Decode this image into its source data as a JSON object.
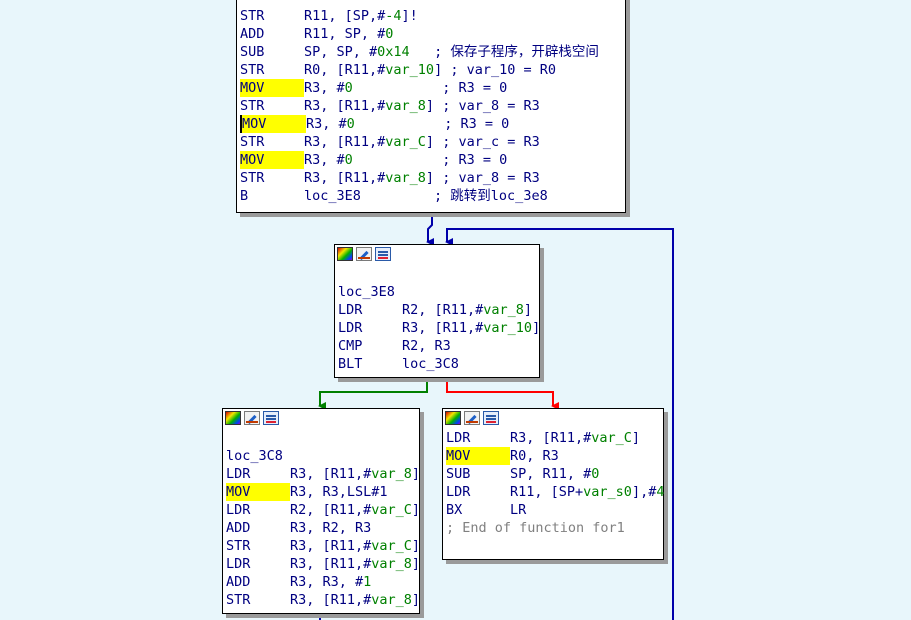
{
  "colors": {
    "background": "#e8f6fb",
    "normal_edge": "#0000aa",
    "true_edge": "#008000",
    "false_edge": "#ff0000",
    "highlight": "#ffff00"
  },
  "icons": [
    "graph-overview-icon",
    "edit-comment-icon",
    "xrefs-icon"
  ],
  "blocks": [
    {
      "id": "entry",
      "label": "",
      "lines": [
        {
          "m": "STR",
          "o": [
            [
              "t",
              "R11, [SP,#"
            ],
            [
              "n",
              "-4"
            ],
            [
              "t",
              "]!"
            ]
          ]
        },
        {
          "m": "ADD",
          "o": [
            [
              "t",
              "R11, SP, #"
            ],
            [
              "n",
              "0"
            ]
          ]
        },
        {
          "m": "SUB",
          "o": [
            [
              "t",
              "SP, SP, #"
            ],
            [
              "n",
              "0x14"
            ],
            [
              "t",
              "   "
            ],
            [
              "c",
              "; 保存子程序，开辟栈空间"
            ]
          ]
        },
        {
          "m": "STR",
          "o": [
            [
              "t",
              "R0, [R11,#"
            ],
            [
              "v",
              "var_10"
            ],
            [
              "t",
              "] "
            ],
            [
              "c",
              "; var_10 = R0"
            ]
          ]
        },
        {
          "m": "MOV",
          "hl": true,
          "o": [
            [
              "t",
              "R3, #"
            ],
            [
              "n",
              "0"
            ],
            [
              "t",
              "           "
            ],
            [
              "c",
              "; R3 = 0"
            ]
          ]
        },
        {
          "m": "STR",
          "o": [
            [
              "t",
              "R3, [R11,#"
            ],
            [
              "v",
              "var_8"
            ],
            [
              "t",
              "] "
            ],
            [
              "c",
              "; var_8 = R3"
            ]
          ]
        },
        {
          "m": "MOV",
          "hl": true,
          "cursor": true,
          "o": [
            [
              "t",
              "R3, #"
            ],
            [
              "n",
              "0"
            ],
            [
              "t",
              "           "
            ],
            [
              "c",
              "; R3 = 0"
            ]
          ]
        },
        {
          "m": "STR",
          "o": [
            [
              "t",
              "R3, [R11,#"
            ],
            [
              "v",
              "var_C"
            ],
            [
              "t",
              "] "
            ],
            [
              "c",
              "; var_c = R3"
            ]
          ]
        },
        {
          "m": "MOV",
          "hl": true,
          "o": [
            [
              "t",
              "R3, #"
            ],
            [
              "n",
              "0"
            ],
            [
              "t",
              "           "
            ],
            [
              "c",
              "; R3 = 0"
            ]
          ]
        },
        {
          "m": "STR",
          "o": [
            [
              "t",
              "R3, [R11,#"
            ],
            [
              "v",
              "var_8"
            ],
            [
              "t",
              "] "
            ],
            [
              "c",
              "; var_8 = R3"
            ]
          ]
        },
        {
          "m": "B",
          "o": [
            [
              "t",
              "loc_3E8         "
            ],
            [
              "c",
              "; 跳转到loc_3e8"
            ]
          ]
        }
      ]
    },
    {
      "id": "loc_3E8",
      "label": "loc_3E8",
      "lines": [
        {
          "m": "LDR",
          "o": [
            [
              "t",
              "R2, [R11,#"
            ],
            [
              "v",
              "var_8"
            ],
            [
              "t",
              "]"
            ]
          ]
        },
        {
          "m": "LDR",
          "o": [
            [
              "t",
              "R3, [R11,#"
            ],
            [
              "v",
              "var_10"
            ],
            [
              "t",
              "]"
            ]
          ]
        },
        {
          "m": "CMP",
          "o": [
            [
              "t",
              "R2, R3"
            ]
          ]
        },
        {
          "m": "BLT",
          "o": [
            [
              "t",
              "loc_3C8"
            ]
          ]
        }
      ]
    },
    {
      "id": "loc_3C8",
      "label": "loc_3C8",
      "lines": [
        {
          "m": "LDR",
          "o": [
            [
              "t",
              "R3, [R11,#"
            ],
            [
              "v",
              "var_8"
            ],
            [
              "t",
              "]"
            ]
          ]
        },
        {
          "m": "MOV",
          "hl": true,
          "o": [
            [
              "t",
              "R3, R3,LSL#1"
            ]
          ]
        },
        {
          "m": "LDR",
          "o": [
            [
              "t",
              "R2, [R11,#"
            ],
            [
              "v",
              "var_C"
            ],
            [
              "t",
              "]"
            ]
          ]
        },
        {
          "m": "ADD",
          "o": [
            [
              "t",
              "R3, R2, R3"
            ]
          ]
        },
        {
          "m": "STR",
          "o": [
            [
              "t",
              "R3, [R11,#"
            ],
            [
              "v",
              "var_C"
            ],
            [
              "t",
              "]"
            ]
          ]
        },
        {
          "m": "LDR",
          "o": [
            [
              "t",
              "R3, [R11,#"
            ],
            [
              "v",
              "var_8"
            ],
            [
              "t",
              "]"
            ]
          ]
        },
        {
          "m": "ADD",
          "o": [
            [
              "t",
              "R3, R3, #"
            ],
            [
              "n",
              "1"
            ]
          ]
        },
        {
          "m": "STR",
          "o": [
            [
              "t",
              "R3, [R11,#"
            ],
            [
              "v",
              "var_8"
            ],
            [
              "t",
              "]"
            ]
          ]
        }
      ]
    },
    {
      "id": "exit",
      "label": "",
      "lines": [
        {
          "m": "LDR",
          "o": [
            [
              "t",
              "R3, [R11,#"
            ],
            [
              "v",
              "var_C"
            ],
            [
              "t",
              "]"
            ]
          ]
        },
        {
          "m": "MOV",
          "hl": true,
          "o": [
            [
              "t",
              "R0, R3"
            ]
          ]
        },
        {
          "m": "SUB",
          "o": [
            [
              "t",
              "SP, R11, #"
            ],
            [
              "n",
              "0"
            ]
          ]
        },
        {
          "m": "LDR",
          "o": [
            [
              "t",
              "R11, [SP+"
            ],
            [
              "v",
              "var_s0"
            ],
            [
              "t",
              "],#"
            ],
            [
              "n",
              "4"
            ]
          ]
        },
        {
          "m": "BX",
          "o": [
            [
              "t",
              "LR"
            ]
          ]
        },
        {
          "f": "; End of function for1"
        }
      ]
    }
  ]
}
